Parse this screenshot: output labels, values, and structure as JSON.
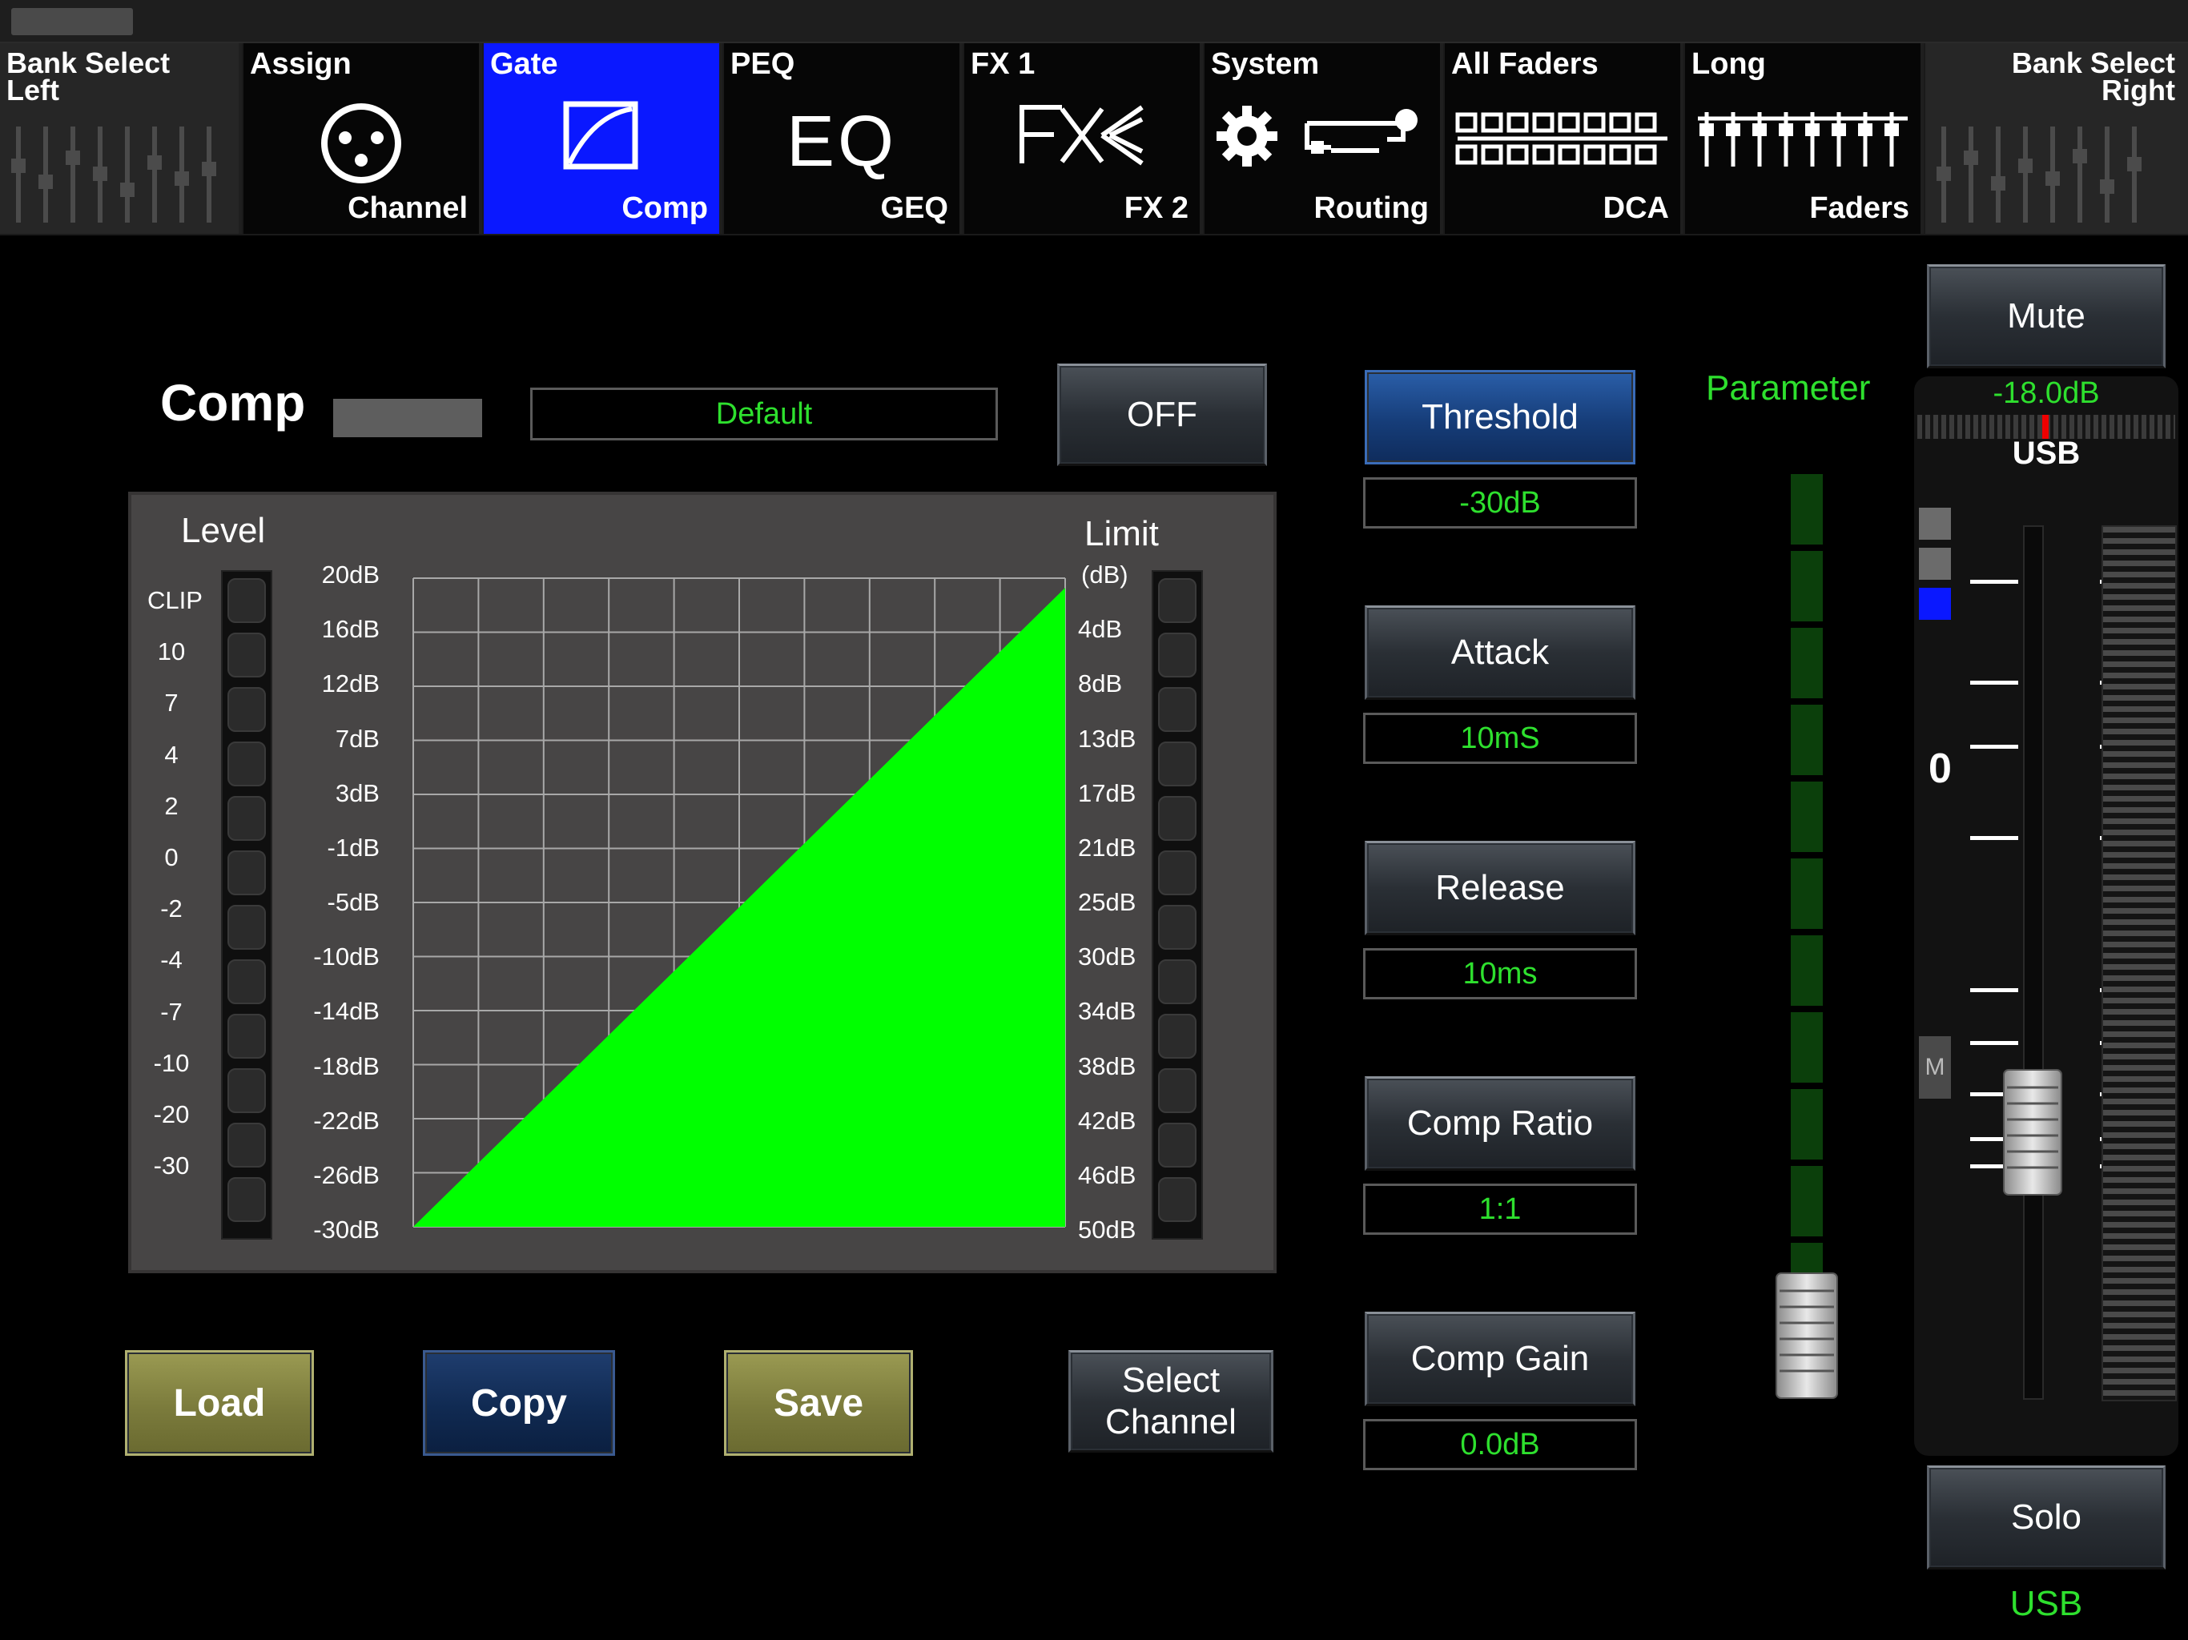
{
  "nav": {
    "tabs": [
      {
        "top": "Bank Select\nLeft",
        "bottom": ""
      },
      {
        "top": "Assign",
        "bottom": "Channel"
      },
      {
        "top": "Gate",
        "bottom": "Comp"
      },
      {
        "top": "PEQ",
        "bottom": "GEQ",
        "icon_text": "EQ"
      },
      {
        "top": "FX 1",
        "bottom": "FX 2"
      },
      {
        "top": "System",
        "bottom": "Routing"
      },
      {
        "top": "All Faders",
        "bottom": "DCA"
      },
      {
        "top": "Long",
        "bottom": "Faders"
      },
      {
        "top": "Bank Select\nRight",
        "bottom": ""
      }
    ],
    "active_index": 2,
    "active_color": "#0a18ff"
  },
  "comp": {
    "title": "Comp",
    "preset": "Default",
    "on_off_label": "OFF"
  },
  "graph": {
    "level_title": "Level",
    "limit_title": "Limit",
    "limit_unit": "(dB)",
    "level_scale": [
      "CLIP",
      "10",
      "7",
      "4",
      "2",
      "0",
      "-2",
      "-4",
      "-7",
      "-10",
      "-20",
      "-30"
    ],
    "y_labels_left": [
      "20dB",
      "16dB",
      "12dB",
      "7dB",
      "3dB",
      "-1dB",
      "-5dB",
      "-10dB",
      "-14dB",
      "-18dB",
      "-22dB",
      "-26dB",
      "-30dB"
    ],
    "y_labels_right": [
      "4dB",
      "8dB",
      "13dB",
      "17dB",
      "21dB",
      "25dB",
      "30dB",
      "34dB",
      "38dB",
      "42dB",
      "46dB",
      "50dB"
    ],
    "fill_color": "#00ff00"
  },
  "params": [
    {
      "label": "Threshold",
      "value": "-30dB",
      "active": true
    },
    {
      "label": "Attack",
      "value": "10mS"
    },
    {
      "label": "Release",
      "value": "10ms"
    },
    {
      "label": "Comp Ratio",
      "value": "1:1"
    },
    {
      "label": "Comp Gain",
      "value": "0.0dB"
    }
  ],
  "parameter_title": "Parameter",
  "parameter_level": 0.03,
  "bottom_buttons": {
    "load": "Load",
    "copy": "Copy",
    "save": "Save",
    "select_channel": "Select Channel"
  },
  "channel": {
    "mute": "Mute",
    "level": "-18.0dB",
    "name_top": "USB",
    "zero_label": "0",
    "m_label": "M",
    "solo": "Solo",
    "name_bottom": "USB"
  },
  "colors": {
    "green_text": "#2ee02e",
    "accent_blue": "#0a18ff"
  }
}
